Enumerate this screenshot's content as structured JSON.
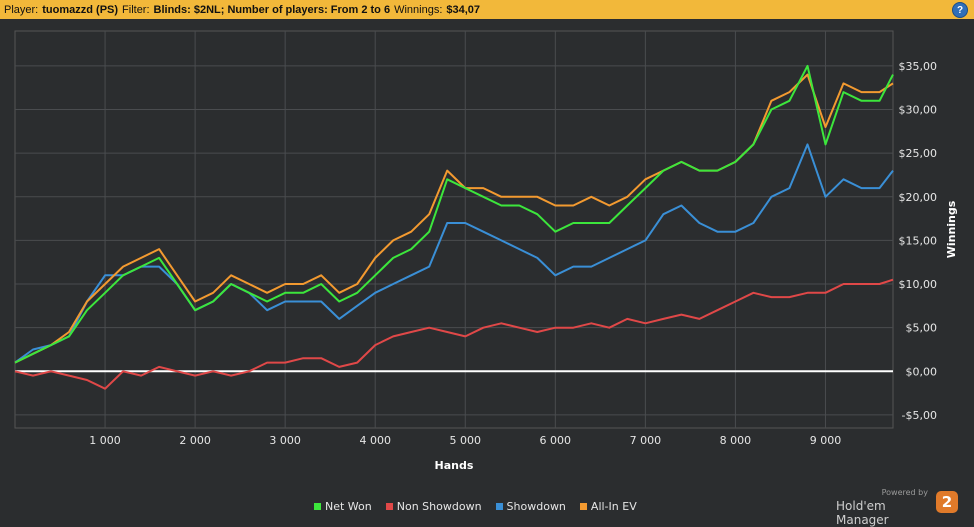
{
  "header": {
    "player_label": "Player:",
    "player_value": "tuomazzd (PS)",
    "filter_label": "Filter:",
    "filter_value": "Blinds: $2NL; Number of players: From 2 to 6",
    "winnings_label": "Winnings:",
    "winnings_value": "$34,07",
    "help_glyph": "?"
  },
  "branding": {
    "powered_by": "Powered by",
    "name": "Hold'em Manager",
    "logo_text": "2"
  },
  "chart_data": {
    "type": "line",
    "xlabel": "Hands",
    "ylabel": "Winnings",
    "xlim": [
      0,
      9750
    ],
    "ylim": [
      -6.5,
      39
    ],
    "x_ticks": [
      1000,
      2000,
      3000,
      4000,
      5000,
      6000,
      7000,
      8000,
      9000
    ],
    "x_tick_labels": [
      "1 000",
      "2 000",
      "3 000",
      "4 000",
      "5 000",
      "6 000",
      "7 000",
      "8 000",
      "9 000"
    ],
    "y_ticks": [
      -5,
      0,
      5,
      10,
      15,
      20,
      25,
      30,
      35
    ],
    "y_tick_labels": [
      "-$5,00",
      "$0,00",
      "$5,00",
      "$10,00",
      "$15,00",
      "$20,00",
      "$25,00",
      "$30,00",
      "$35,00"
    ],
    "grid": true,
    "legend_position": "bottom",
    "colors": {
      "background": "#2b2d2f",
      "grid": "#4a4c4f",
      "zero_line": "#ffffff"
    },
    "series": [
      {
        "name": "Net Won",
        "color": "#3ce63c",
        "x": [
          0,
          200,
          400,
          600,
          800,
          1000,
          1200,
          1400,
          1600,
          1800,
          2000,
          2200,
          2400,
          2600,
          2800,
          3000,
          3200,
          3400,
          3600,
          3800,
          4000,
          4200,
          4400,
          4600,
          4800,
          5000,
          5200,
          5400,
          5600,
          5800,
          6000,
          6200,
          6400,
          6600,
          6800,
          7000,
          7200,
          7400,
          7600,
          7800,
          8000,
          8200,
          8400,
          8600,
          8800,
          9000,
          9200,
          9400,
          9600,
          9750
        ],
        "values": [
          1,
          2,
          3,
          4,
          7,
          9,
          11,
          12,
          13,
          10,
          7,
          8,
          10,
          9,
          8,
          9,
          9,
          10,
          8,
          9,
          11,
          13,
          14,
          16,
          22,
          21,
          20,
          19,
          19,
          18,
          16,
          17,
          17,
          17,
          19,
          21,
          23,
          24,
          23,
          23,
          24,
          26,
          30,
          31,
          35,
          26,
          32,
          31,
          31,
          34
        ]
      },
      {
        "name": "Non Showdown",
        "color": "#e04848",
        "x": [
          0,
          200,
          400,
          600,
          800,
          1000,
          1200,
          1400,
          1600,
          1800,
          2000,
          2200,
          2400,
          2600,
          2800,
          3000,
          3200,
          3400,
          3600,
          3800,
          4000,
          4200,
          4400,
          4600,
          4800,
          5000,
          5200,
          5400,
          5600,
          5800,
          6000,
          6200,
          6400,
          6600,
          6800,
          7000,
          7200,
          7400,
          7600,
          7800,
          8000,
          8200,
          8400,
          8600,
          8800,
          9000,
          9200,
          9400,
          9600,
          9750
        ],
        "values": [
          0,
          -0.5,
          0,
          -0.5,
          -1,
          -2,
          0,
          -0.5,
          0.5,
          0,
          -0.5,
          0,
          -0.5,
          0,
          1,
          1,
          1.5,
          1.5,
          0.5,
          1,
          3,
          4,
          4.5,
          5,
          4.5,
          4,
          5,
          5.5,
          5,
          4.5,
          5,
          5,
          5.5,
          5,
          6,
          5.5,
          6,
          6.5,
          6,
          7,
          8,
          9,
          8.5,
          8.5,
          9,
          9,
          10,
          10,
          10,
          10.5
        ]
      },
      {
        "name": "Showdown",
        "color": "#3a8fd6",
        "x": [
          0,
          200,
          400,
          600,
          800,
          1000,
          1200,
          1400,
          1600,
          1800,
          2000,
          2200,
          2400,
          2600,
          2800,
          3000,
          3200,
          3400,
          3600,
          3800,
          4000,
          4200,
          4400,
          4600,
          4800,
          5000,
          5200,
          5400,
          5600,
          5800,
          6000,
          6200,
          6400,
          6600,
          6800,
          7000,
          7200,
          7400,
          7600,
          7800,
          8000,
          8200,
          8400,
          8600,
          8800,
          9000,
          9200,
          9400,
          9600,
          9750
        ],
        "values": [
          1,
          2.5,
          3,
          4,
          8,
          11,
          11,
          12,
          12,
          10,
          7,
          8,
          10,
          9,
          7,
          8,
          8,
          8,
          6,
          7.5,
          9,
          10,
          11,
          12,
          17,
          17,
          16,
          15,
          14,
          13,
          11,
          12,
          12,
          13,
          14,
          15,
          18,
          19,
          17,
          16,
          16,
          17,
          20,
          21,
          26,
          20,
          22,
          21,
          21,
          23
        ]
      },
      {
        "name": "All-In EV",
        "color": "#f39a30",
        "x": [
          0,
          200,
          400,
          600,
          800,
          1000,
          1200,
          1400,
          1600,
          1800,
          2000,
          2200,
          2400,
          2600,
          2800,
          3000,
          3200,
          3400,
          3600,
          3800,
          4000,
          4200,
          4400,
          4600,
          4800,
          5000,
          5200,
          5400,
          5600,
          5800,
          6000,
          6200,
          6400,
          6600,
          6800,
          7000,
          7200,
          7400,
          7600,
          7800,
          8000,
          8200,
          8400,
          8600,
          8800,
          9000,
          9200,
          9400,
          9600,
          9750
        ],
        "values": [
          1,
          2,
          3,
          4.5,
          8,
          10,
          12,
          13,
          14,
          11,
          8,
          9,
          11,
          10,
          9,
          10,
          10,
          11,
          9,
          10,
          13,
          15,
          16,
          18,
          23,
          21,
          21,
          20,
          20,
          20,
          19,
          19,
          20,
          19,
          20,
          22,
          23,
          24,
          23,
          23,
          24,
          26,
          31,
          32,
          34,
          28,
          33,
          32,
          32,
          33
        ]
      }
    ]
  }
}
